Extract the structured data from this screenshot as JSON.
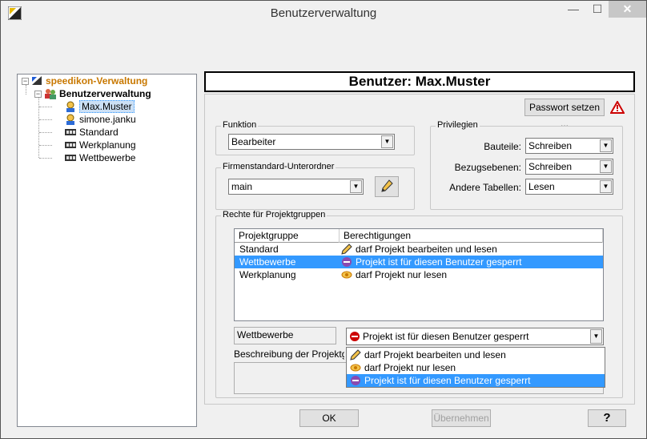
{
  "window": {
    "title": "Benutzerverwaltung",
    "close_glyph": "✕",
    "min_glyph": "—",
    "max_glyph": "☐"
  },
  "tree": {
    "root": "speedikon-Verwaltung",
    "group": "Benutzerverwaltung",
    "items": [
      {
        "label": "Max.Muster",
        "type": "user",
        "selected": true
      },
      {
        "label": "simone.janku",
        "type": "user",
        "selected": false
      },
      {
        "label": "Standard",
        "type": "projectgroup",
        "selected": false
      },
      {
        "label": "Werkplanung",
        "type": "projectgroup",
        "selected": false
      },
      {
        "label": "Wettbewerbe",
        "type": "projectgroup",
        "selected": false
      }
    ]
  },
  "header": {
    "title": "Benutzer: Max.Muster"
  },
  "password_button": "Passwort setzen ...",
  "funktion": {
    "label": "Funktion",
    "value": "Bearbeiter"
  },
  "firmenstandard": {
    "label": "Firmenstandard-Unterordner",
    "value": "main"
  },
  "privilegien": {
    "label": "Privilegien",
    "rows": [
      {
        "label": "Bauteile:",
        "value": "Schreiben"
      },
      {
        "label": "Bezugsebenen:",
        "value": "Schreiben"
      },
      {
        "label": "Andere Tabellen:",
        "value": "Lesen"
      }
    ]
  },
  "rechte": {
    "label": "Rechte für Projektgruppen",
    "columns": [
      "Projektgruppe",
      "Berechtigungen"
    ],
    "rows": [
      {
        "group": "Standard",
        "permission": "darf Projekt bearbeiten und lesen",
        "icon": "pencil-icon"
      },
      {
        "group": "Wettbewerbe",
        "permission": "Projekt ist für diesen Benutzer gesperrt",
        "icon": "blocked-icon",
        "selected": true
      },
      {
        "group": "Werkplanung",
        "permission": "darf Projekt nur lesen",
        "icon": "eye-icon"
      }
    ],
    "selected_group": "Wettbewerbe",
    "selected_permission": "Projekt ist für diesen Benutzer gesperrt",
    "options": [
      {
        "label": "darf Projekt bearbeiten und lesen",
        "icon": "pencil-icon"
      },
      {
        "label": "darf Projekt nur lesen",
        "icon": "eye-icon"
      },
      {
        "label": "Projekt ist für diesen Benutzer gesperrt",
        "icon": "blocked-icon",
        "highlighted": true
      }
    ],
    "description_label": "Beschreibung der Projektgrup"
  },
  "buttons": {
    "ok": "OK",
    "apply": "Übernehmen",
    "help": "?"
  },
  "colors": {
    "accent": "#3399ff",
    "warning": "#cc0000",
    "tree_root": "#c87800"
  }
}
